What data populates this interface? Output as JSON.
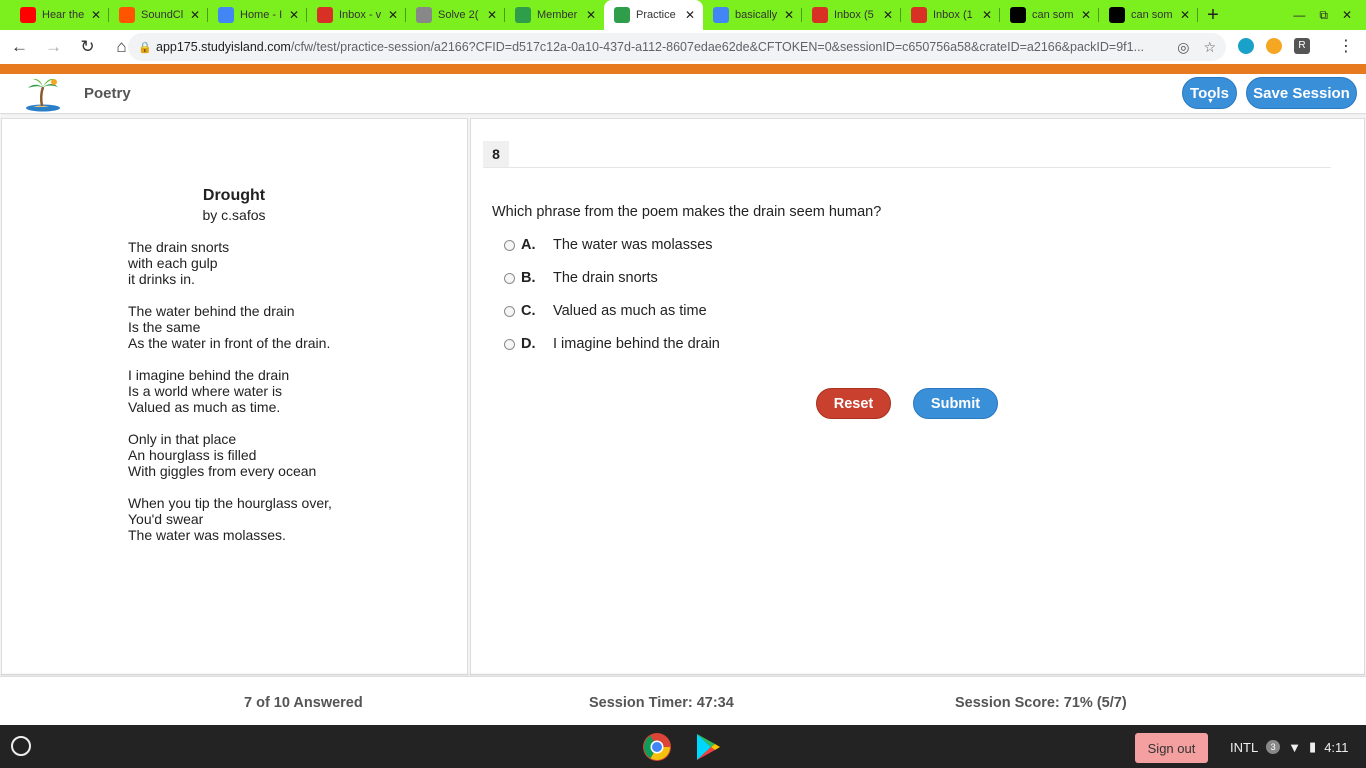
{
  "browser": {
    "tabs": [
      {
        "title": "Hear the",
        "icon": "youtube-icon",
        "color": "#ff0000"
      },
      {
        "title": "SoundCl",
        "icon": "soundcloud-icon",
        "color": "#ff5500"
      },
      {
        "title": "Home - I",
        "icon": "chrome-icon",
        "color": "#4285f4"
      },
      {
        "title": "Inbox - v",
        "icon": "gmail-icon",
        "color": "#d93025"
      },
      {
        "title": "Solve 2(",
        "icon": "site-icon",
        "color": "#888888"
      },
      {
        "title": "Member",
        "icon": "palm-icon",
        "color": "#2e9e4a"
      },
      {
        "title": "Practice",
        "icon": "palm-icon",
        "color": "#2e9e4a"
      },
      {
        "title": "basically",
        "icon": "google-icon",
        "color": "#4285f4"
      },
      {
        "title": "Inbox (5",
        "icon": "gmail-icon",
        "color": "#d93025"
      },
      {
        "title": "Inbox (1",
        "icon": "gmail-icon",
        "color": "#d93025"
      },
      {
        "title": "can som",
        "icon": "brainly-icon",
        "color": "#000000"
      },
      {
        "title": "can som",
        "icon": "brainly-icon",
        "color": "#000000"
      }
    ],
    "url_host": "app175.studyisland.com",
    "url_path": "/cfw/test/practice-session/a2166?CFID=d517c12a-0a10-437d-a112-8607edae62de&CFTOKEN=0&sessionID=c650756a58&crateID=a2166&packID=9f1..."
  },
  "header": {
    "title": "Poetry",
    "tools_label": "Tools",
    "save_label": "Save Session"
  },
  "poem": {
    "title": "Drought",
    "author": "by c.safos",
    "stanzas": [
      [
        "The drain snorts",
        "with each gulp",
        "it drinks in."
      ],
      [
        "The water behind the drain",
        "Is the same",
        "As the water in front of the drain."
      ],
      [
        "I imagine behind the drain",
        "Is a world where water is",
        "Valued as much as time."
      ],
      [
        "Only in that place",
        "An hourglass is filled",
        "With giggles from every ocean"
      ],
      [
        "When you tip the hourglass over,",
        "You'd swear",
        "The water was molasses."
      ]
    ]
  },
  "question": {
    "number": "8",
    "text": "Which phrase from the poem makes the drain seem human?",
    "choices": [
      {
        "letter": "A.",
        "text": "The water was molasses"
      },
      {
        "letter": "B.",
        "text": "The drain snorts"
      },
      {
        "letter": "C.",
        "text": "Valued as much as time"
      },
      {
        "letter": "D.",
        "text": "I imagine behind the drain"
      }
    ],
    "reset_label": "Reset",
    "submit_label": "Submit"
  },
  "status": {
    "answered": "7 of 10 Answered",
    "timer": "Session Timer: 47:34",
    "score": "Session Score: 71% (5/7)"
  },
  "shelf": {
    "signout_label": "Sign out",
    "keyboard": "INTL",
    "notifications": "3",
    "time": "4:11"
  }
}
